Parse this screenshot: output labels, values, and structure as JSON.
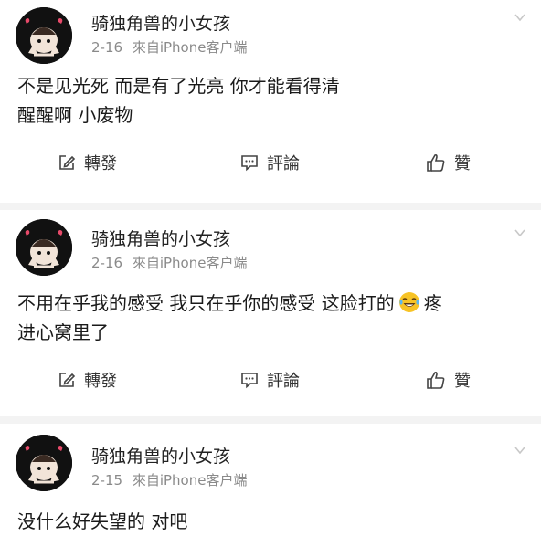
{
  "posts": [
    {
      "username": "骑独角兽的小女孩",
      "date": "2-16",
      "source": "來自iPhone客户端",
      "lines": [
        "不是见光死 而是有了光亮 你才能看得清",
        "醒醒啊 小废物"
      ],
      "emoji": null,
      "actions": {
        "repost": "轉發",
        "comment": "評論",
        "like": "贊"
      }
    },
    {
      "username": "骑独角兽的小女孩",
      "date": "2-16",
      "source": "來自iPhone客户端",
      "lines": [
        "不用在乎我的感受 我只在乎你的感受 这脸打的",
        "进心窝里了"
      ],
      "line1_tail": "疼",
      "emoji": "laughing-tears-emoji",
      "actions": {
        "repost": "轉發",
        "comment": "評論",
        "like": "贊"
      }
    },
    {
      "username": "骑独角兽的小女孩",
      "date": "2-15",
      "source": "來自iPhone客户端",
      "lines": [
        "没什么好失望的 对吧"
      ],
      "emoji": null
    }
  ],
  "icons": {
    "repost": "edit-square-icon",
    "comment": "comment-bubble-icon",
    "like": "thumbs-up-icon",
    "more": "chevron-down-icon"
  },
  "colors": {
    "meta_text": "#8a8a8a",
    "avatar_bg": "#111111",
    "divider": "#f3f3f3",
    "emoji_yellow": "#f7c325"
  }
}
